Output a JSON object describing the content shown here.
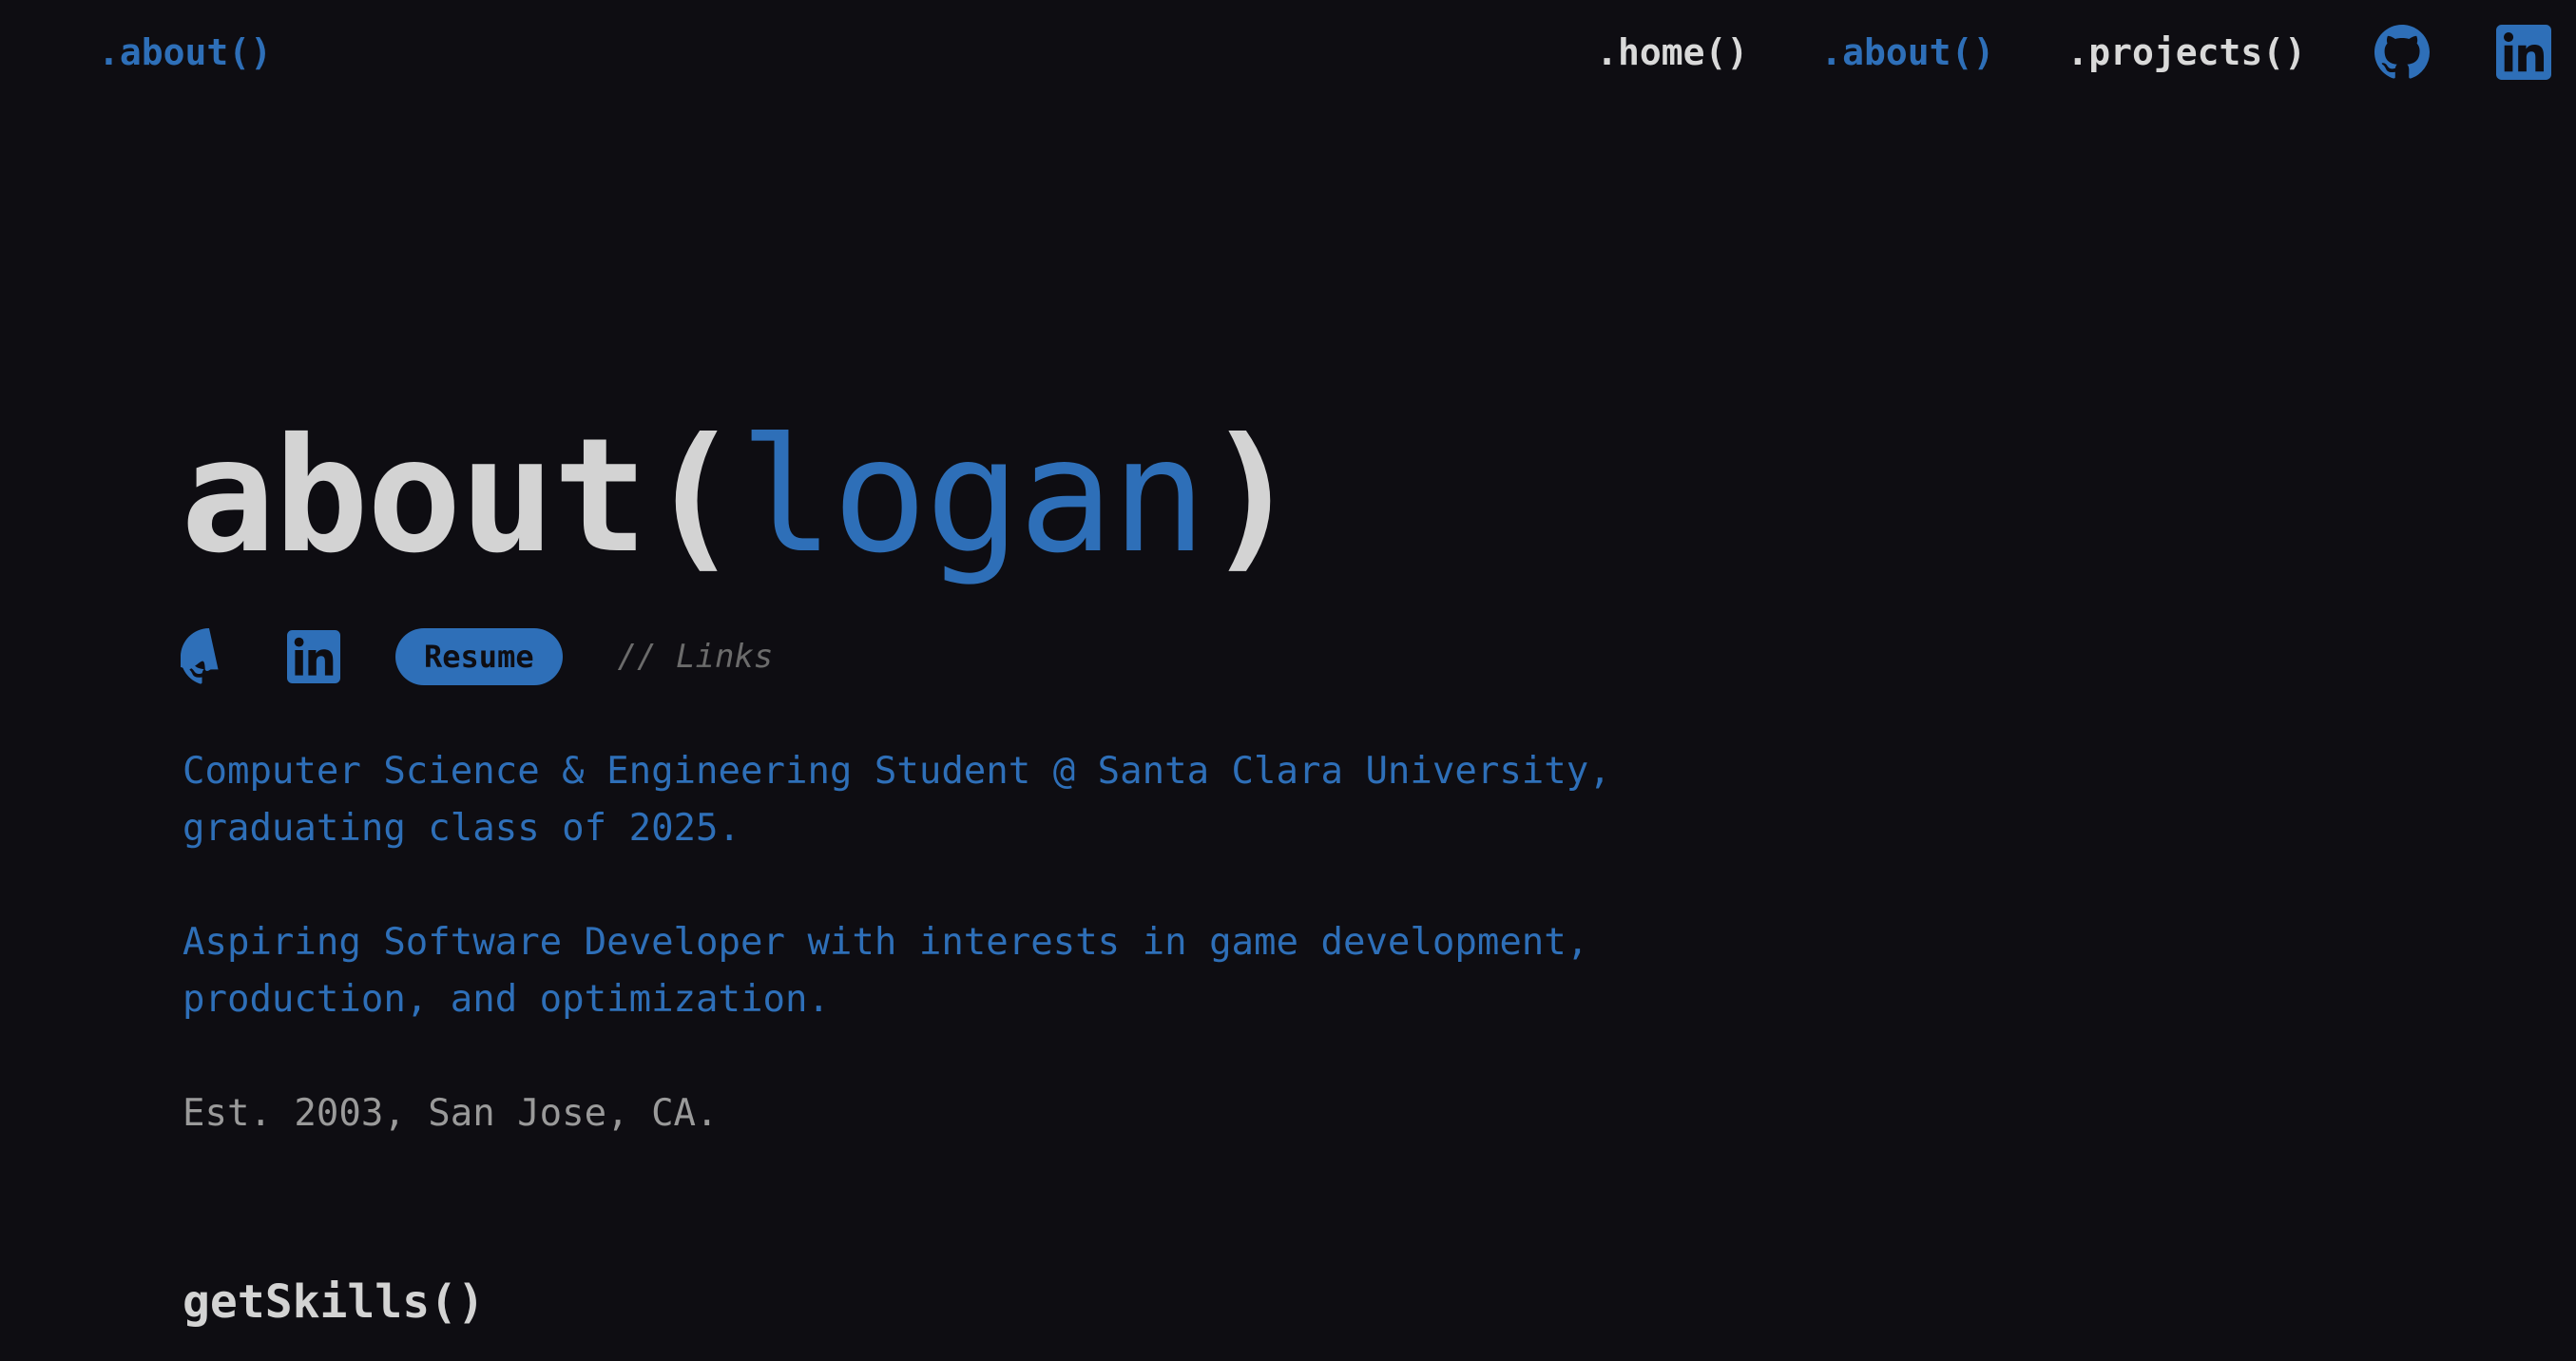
{
  "nav": {
    "brand": ".about()",
    "links": [
      {
        "label": ".home()",
        "active": false
      },
      {
        "label": ".about()",
        "active": true
      },
      {
        "label": ".projects()",
        "active": false
      }
    ],
    "icons": [
      "github-icon",
      "linkedin-icon"
    ]
  },
  "hero": {
    "title_fn": "about(",
    "title_arg": "logan",
    "title_close": ")"
  },
  "links": {
    "icons": [
      "github-icon",
      "linkedin-icon"
    ],
    "resume_label": "Resume",
    "comment": "// Links"
  },
  "bio": {
    "line1": "Computer Science & Engineering Student @ Santa Clara University, graduating class of 2025.",
    "line2": "Aspiring Software Developer with interests in game development, production, and optimization.",
    "line3": "Est. 2003, San Jose, CA."
  },
  "skills": {
    "title": "getSkills()"
  },
  "colors": {
    "background": "#0e0d12",
    "accent": "#2e6fb8",
    "text": "#d3d3d3",
    "muted": "#9a9a9a"
  }
}
